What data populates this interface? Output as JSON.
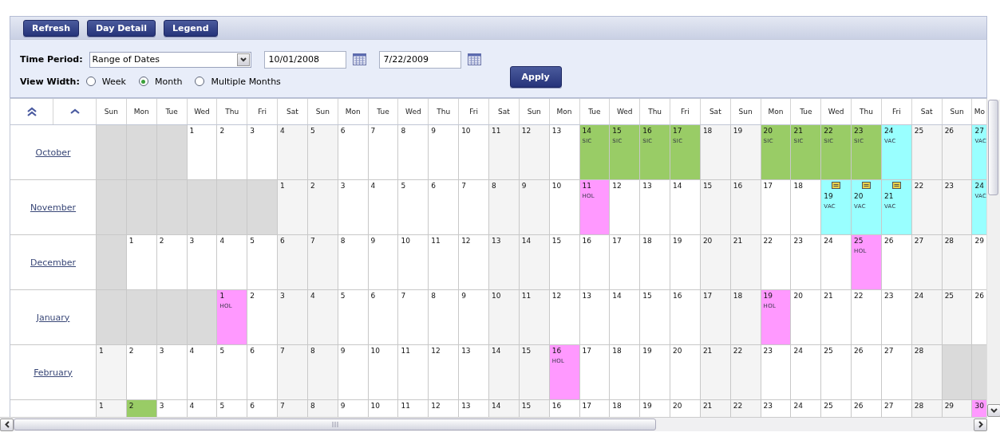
{
  "toolbar": {
    "buttons": [
      "Refresh",
      "Day Detail",
      "Legend"
    ]
  },
  "filters": {
    "time_period_label": "Time Period:",
    "time_period": "Range of Dates",
    "start_date": "10/01/2008",
    "end_date": "7/22/2009",
    "apply": "Apply",
    "view_width_label": "View Width:",
    "view_width": [
      {
        "label": "Week",
        "selected": false
      },
      {
        "label": "Month",
        "selected": true
      },
      {
        "label": "Multiple Months",
        "selected": false
      }
    ]
  },
  "grid": {
    "weekdays": [
      "Sun",
      "Mon",
      "Tue",
      "Wed",
      "Thu",
      "Fri",
      "Sat",
      "Sun",
      "Mon",
      "Tue",
      "Wed",
      "Thu",
      "Fri",
      "Sat",
      "Sun",
      "Mon",
      "Tue",
      "Wed",
      "Thu",
      "Fri",
      "Sat",
      "Sun",
      "Mon",
      "Tue",
      "Wed",
      "Thu",
      "Fri",
      "Sat",
      "Sun",
      "Mo"
    ],
    "months": [
      {
        "label": "October",
        "cells": [
          {
            "kind": "blank"
          },
          {
            "kind": "blank"
          },
          {
            "kind": "blank"
          },
          {
            "kind": "day",
            "day": "1"
          },
          {
            "kind": "day",
            "day": "2"
          },
          {
            "kind": "day",
            "day": "3"
          },
          {
            "kind": "day",
            "day": "4"
          },
          {
            "kind": "day",
            "day": "5"
          },
          {
            "kind": "day",
            "day": "6"
          },
          {
            "kind": "day",
            "day": "7"
          },
          {
            "kind": "day",
            "day": "8"
          },
          {
            "kind": "day",
            "day": "9"
          },
          {
            "kind": "day",
            "day": "10"
          },
          {
            "kind": "day",
            "day": "11"
          },
          {
            "kind": "day",
            "day": "12"
          },
          {
            "kind": "day",
            "day": "13"
          },
          {
            "kind": "day",
            "day": "14",
            "color": "#99cc66",
            "code": "SIC"
          },
          {
            "kind": "day",
            "day": "15",
            "color": "#99cc66",
            "code": "SIC"
          },
          {
            "kind": "day",
            "day": "16",
            "color": "#99cc66",
            "code": "SIC"
          },
          {
            "kind": "day",
            "day": "17",
            "color": "#99cc66",
            "code": "SIC"
          },
          {
            "kind": "day",
            "day": "18"
          },
          {
            "kind": "day",
            "day": "19"
          },
          {
            "kind": "day",
            "day": "20",
            "color": "#99cc66",
            "code": "SIC"
          },
          {
            "kind": "day",
            "day": "21",
            "color": "#99cc66",
            "code": "SIC"
          },
          {
            "kind": "day",
            "day": "22",
            "color": "#99cc66",
            "code": "SIC"
          },
          {
            "kind": "day",
            "day": "23",
            "color": "#99cc66",
            "code": "SIC"
          },
          {
            "kind": "day",
            "day": "24",
            "color": "#99ffff",
            "code": "VAC"
          },
          {
            "kind": "day",
            "day": "25"
          },
          {
            "kind": "day",
            "day": "26"
          },
          {
            "kind": "day",
            "day": "27",
            "color": "#99ffff",
            "code": "VAC"
          }
        ]
      },
      {
        "label": "November",
        "cells": [
          {
            "kind": "blank"
          },
          {
            "kind": "blank"
          },
          {
            "kind": "blank"
          },
          {
            "kind": "blank"
          },
          {
            "kind": "blank"
          },
          {
            "kind": "blank"
          },
          {
            "kind": "day",
            "day": "1"
          },
          {
            "kind": "day",
            "day": "2"
          },
          {
            "kind": "day",
            "day": "3"
          },
          {
            "kind": "day",
            "day": "4"
          },
          {
            "kind": "day",
            "day": "5"
          },
          {
            "kind": "day",
            "day": "6"
          },
          {
            "kind": "day",
            "day": "7"
          },
          {
            "kind": "day",
            "day": "8"
          },
          {
            "kind": "day",
            "day": "9"
          },
          {
            "kind": "day",
            "day": "10"
          },
          {
            "kind": "day",
            "day": "11",
            "color": "#ff99ff",
            "code": "HOL"
          },
          {
            "kind": "day",
            "day": "12"
          },
          {
            "kind": "day",
            "day": "13"
          },
          {
            "kind": "day",
            "day": "14"
          },
          {
            "kind": "day",
            "day": "15"
          },
          {
            "kind": "day",
            "day": "16"
          },
          {
            "kind": "day",
            "day": "17"
          },
          {
            "kind": "day",
            "day": "18"
          },
          {
            "kind": "day",
            "day": "19",
            "color": "#99ffff",
            "code": "VAC",
            "note": true
          },
          {
            "kind": "day",
            "day": "20",
            "color": "#99ffff",
            "code": "VAC",
            "note": true
          },
          {
            "kind": "day",
            "day": "21",
            "color": "#99ffff",
            "code": "VAC",
            "note": true
          },
          {
            "kind": "day",
            "day": "22"
          },
          {
            "kind": "day",
            "day": "23"
          },
          {
            "kind": "day",
            "day": "24",
            "color": "#99ffff",
            "code": "VAC"
          }
        ]
      },
      {
        "label": "December",
        "cells": [
          {
            "kind": "blank"
          },
          {
            "kind": "day",
            "day": "1"
          },
          {
            "kind": "day",
            "day": "2"
          },
          {
            "kind": "day",
            "day": "3"
          },
          {
            "kind": "day",
            "day": "4"
          },
          {
            "kind": "day",
            "day": "5"
          },
          {
            "kind": "day",
            "day": "6"
          },
          {
            "kind": "day",
            "day": "7"
          },
          {
            "kind": "day",
            "day": "8"
          },
          {
            "kind": "day",
            "day": "9"
          },
          {
            "kind": "day",
            "day": "10"
          },
          {
            "kind": "day",
            "day": "11"
          },
          {
            "kind": "day",
            "day": "12"
          },
          {
            "kind": "day",
            "day": "13"
          },
          {
            "kind": "day",
            "day": "14"
          },
          {
            "kind": "day",
            "day": "15"
          },
          {
            "kind": "day",
            "day": "16"
          },
          {
            "kind": "day",
            "day": "17"
          },
          {
            "kind": "day",
            "day": "18"
          },
          {
            "kind": "day",
            "day": "19"
          },
          {
            "kind": "day",
            "day": "20"
          },
          {
            "kind": "day",
            "day": "21"
          },
          {
            "kind": "day",
            "day": "22"
          },
          {
            "kind": "day",
            "day": "23"
          },
          {
            "kind": "day",
            "day": "24"
          },
          {
            "kind": "day",
            "day": "25",
            "color": "#ff99ff",
            "code": "HOL"
          },
          {
            "kind": "day",
            "day": "26"
          },
          {
            "kind": "day",
            "day": "27"
          },
          {
            "kind": "day",
            "day": "28"
          },
          {
            "kind": "day",
            "day": "29"
          }
        ]
      },
      {
        "label": "January",
        "cells": [
          {
            "kind": "blank"
          },
          {
            "kind": "blank"
          },
          {
            "kind": "blank"
          },
          {
            "kind": "blank"
          },
          {
            "kind": "day",
            "day": "1",
            "color": "#ff99ff",
            "code": "HOL"
          },
          {
            "kind": "day",
            "day": "2"
          },
          {
            "kind": "day",
            "day": "3"
          },
          {
            "kind": "day",
            "day": "4"
          },
          {
            "kind": "day",
            "day": "5"
          },
          {
            "kind": "day",
            "day": "6"
          },
          {
            "kind": "day",
            "day": "7"
          },
          {
            "kind": "day",
            "day": "8"
          },
          {
            "kind": "day",
            "day": "9"
          },
          {
            "kind": "day",
            "day": "10"
          },
          {
            "kind": "day",
            "day": "11"
          },
          {
            "kind": "day",
            "day": "12"
          },
          {
            "kind": "day",
            "day": "13"
          },
          {
            "kind": "day",
            "day": "14"
          },
          {
            "kind": "day",
            "day": "15"
          },
          {
            "kind": "day",
            "day": "16"
          },
          {
            "kind": "day",
            "day": "17"
          },
          {
            "kind": "day",
            "day": "18"
          },
          {
            "kind": "day",
            "day": "19",
            "color": "#ff99ff",
            "code": "HOL"
          },
          {
            "kind": "day",
            "day": "20"
          },
          {
            "kind": "day",
            "day": "21"
          },
          {
            "kind": "day",
            "day": "22"
          },
          {
            "kind": "day",
            "day": "23"
          },
          {
            "kind": "day",
            "day": "24"
          },
          {
            "kind": "day",
            "day": "25"
          },
          {
            "kind": "day",
            "day": "26"
          }
        ]
      },
      {
        "label": "February",
        "cells": [
          {
            "kind": "day",
            "day": "1"
          },
          {
            "kind": "day",
            "day": "2"
          },
          {
            "kind": "day",
            "day": "3"
          },
          {
            "kind": "day",
            "day": "4"
          },
          {
            "kind": "day",
            "day": "5"
          },
          {
            "kind": "day",
            "day": "6"
          },
          {
            "kind": "day",
            "day": "7"
          },
          {
            "kind": "day",
            "day": "8"
          },
          {
            "kind": "day",
            "day": "9"
          },
          {
            "kind": "day",
            "day": "10"
          },
          {
            "kind": "day",
            "day": "11"
          },
          {
            "kind": "day",
            "day": "12"
          },
          {
            "kind": "day",
            "day": "13"
          },
          {
            "kind": "day",
            "day": "14"
          },
          {
            "kind": "day",
            "day": "15"
          },
          {
            "kind": "day",
            "day": "16",
            "color": "#ff99ff",
            "code": "HOL"
          },
          {
            "kind": "day",
            "day": "17"
          },
          {
            "kind": "day",
            "day": "18"
          },
          {
            "kind": "day",
            "day": "19"
          },
          {
            "kind": "day",
            "day": "20"
          },
          {
            "kind": "day",
            "day": "21"
          },
          {
            "kind": "day",
            "day": "22"
          },
          {
            "kind": "day",
            "day": "23"
          },
          {
            "kind": "day",
            "day": "24"
          },
          {
            "kind": "day",
            "day": "25"
          },
          {
            "kind": "day",
            "day": "26"
          },
          {
            "kind": "day",
            "day": "27"
          },
          {
            "kind": "day",
            "day": "28"
          },
          {
            "kind": "blank"
          },
          {
            "kind": "blank"
          }
        ]
      },
      {
        "cells": [
          {
            "kind": "day",
            "day": "1"
          },
          {
            "kind": "day",
            "day": "2",
            "color": "#99cc66"
          },
          {
            "kind": "day",
            "day": "3"
          },
          {
            "kind": "day",
            "day": "4"
          },
          {
            "kind": "day",
            "day": "5"
          },
          {
            "kind": "day",
            "day": "6"
          },
          {
            "kind": "day",
            "day": "7"
          },
          {
            "kind": "day",
            "day": "8"
          },
          {
            "kind": "day",
            "day": "9"
          },
          {
            "kind": "day",
            "day": "10"
          },
          {
            "kind": "day",
            "day": "11"
          },
          {
            "kind": "day",
            "day": "12"
          },
          {
            "kind": "day",
            "day": "13"
          },
          {
            "kind": "day",
            "day": "14"
          },
          {
            "kind": "day",
            "day": "15"
          },
          {
            "kind": "day",
            "day": "16"
          },
          {
            "kind": "day",
            "day": "17"
          },
          {
            "kind": "day",
            "day": "18"
          },
          {
            "kind": "day",
            "day": "19"
          },
          {
            "kind": "day",
            "day": "20"
          },
          {
            "kind": "day",
            "day": "21"
          },
          {
            "kind": "day",
            "day": "22"
          },
          {
            "kind": "day",
            "day": "23"
          },
          {
            "kind": "day",
            "day": "24"
          },
          {
            "kind": "day",
            "day": "25"
          },
          {
            "kind": "day",
            "day": "26"
          },
          {
            "kind": "day",
            "day": "27"
          },
          {
            "kind": "day",
            "day": "28"
          },
          {
            "kind": "day",
            "day": "29"
          },
          {
            "kind": "day",
            "day": "30",
            "color": "#ff99ff"
          }
        ]
      }
    ]
  }
}
